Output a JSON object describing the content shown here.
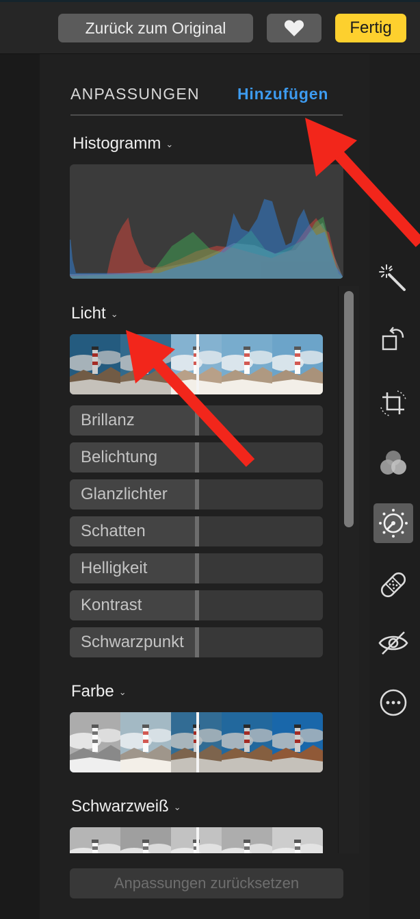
{
  "toolbar": {
    "revert_label": "Zurück zum Original",
    "favorite_icon": "heart-icon",
    "done_label": "Fertig",
    "done_color": "#fdd02e"
  },
  "tabs": {
    "adjust_label": "ANPASSUNGEN",
    "add_label": "Hinzufügen",
    "add_color": "#3d9bf0"
  },
  "sections": {
    "histogram": {
      "title": "Histogramm"
    },
    "light": {
      "title": "Licht"
    },
    "color": {
      "title": "Farbe"
    },
    "bw": {
      "title": "Schwarzweiß"
    }
  },
  "light_sliders": [
    {
      "label": "Brillanz"
    },
    {
      "label": "Belichtung"
    },
    {
      "label": "Glanzlichter"
    },
    {
      "label": "Schatten"
    },
    {
      "label": "Helligkeit"
    },
    {
      "label": "Kontrast"
    },
    {
      "label": "Schwarzpunkt"
    }
  ],
  "reset_label": "Anpassungen zurücksetzen",
  "tools": [
    {
      "icon": "magic-wand-icon"
    },
    {
      "icon": "rotate-icon"
    },
    {
      "icon": "straighten-crop-icon"
    },
    {
      "icon": "filters-icon"
    },
    {
      "icon": "adjust-icon",
      "active": true
    },
    {
      "icon": "retouch-bandage-icon"
    },
    {
      "icon": "red-eye-icon"
    },
    {
      "icon": "more-icon"
    }
  ],
  "histogram_colors": {
    "red": "#e8473b",
    "green": "#42c25a",
    "blue": "#2f8bf0"
  },
  "annotation_arrow_color": "#f2261b"
}
